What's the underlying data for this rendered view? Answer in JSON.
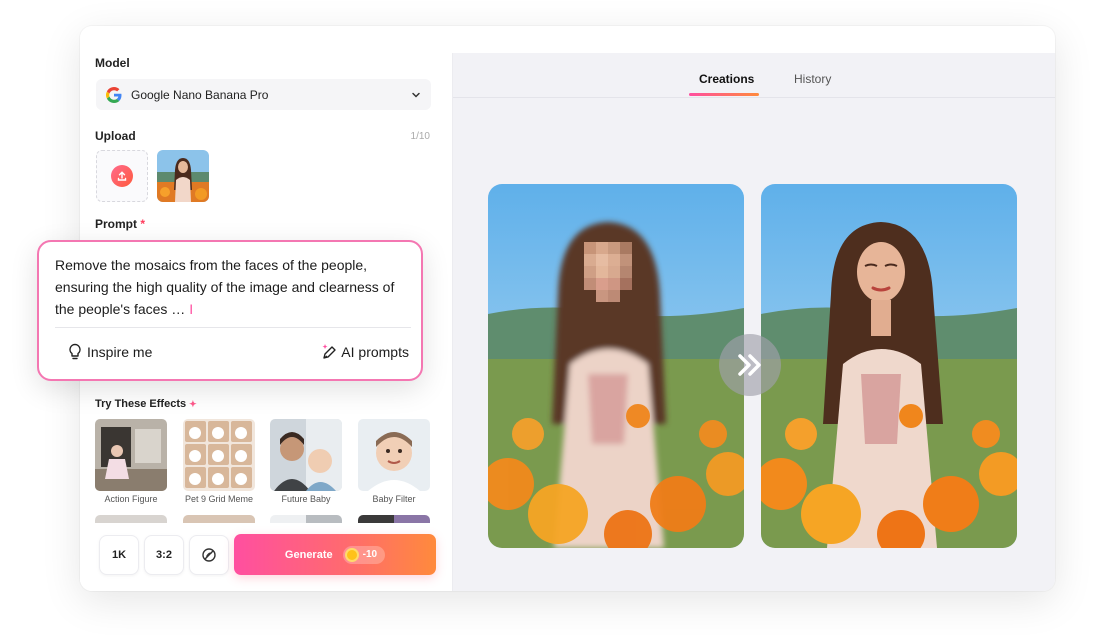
{
  "sidebar": {
    "model_label": "Model",
    "model_value": "Google Nano Banana Pro",
    "upload_label": "Upload",
    "upload_count": "1/10",
    "prompt_label": "Prompt",
    "prompt_required": "*",
    "effects_label": "Try These Effects",
    "effects": [
      {
        "label": "Action Figure"
      },
      {
        "label": "Pet 9 Grid Meme"
      },
      {
        "label": "Future Baby"
      },
      {
        "label": "Baby Filter"
      }
    ]
  },
  "prompt_card": {
    "text": "Remove the mosaics from the faces of the people, ensuring the high quality of the image and clearness of the people's faces …",
    "cursor": "I",
    "inspire_label": "Inspire me",
    "ai_prompts_label": "AI prompts"
  },
  "toolbar": {
    "resolution": "1K",
    "ratio": "3:2",
    "generate_label": "Generate",
    "cost": "-10"
  },
  "tabs": [
    {
      "label": "Creations",
      "active": true
    },
    {
      "label": "History",
      "active": false
    }
  ],
  "colors": {
    "accent_start": "#ff4fa0",
    "accent_end": "#ff8a3c",
    "traffic_red": "#f2426b",
    "traffic_yellow": "#f5b52a",
    "traffic_green": "#2fc653"
  },
  "icons": [
    "google-icon",
    "chevron-down-icon",
    "upload-icon",
    "lightbulb-icon",
    "pen-sparkle-icon",
    "sparkle-icon",
    "no-style-icon",
    "coin-icon",
    "double-chevron-right-icon"
  ]
}
